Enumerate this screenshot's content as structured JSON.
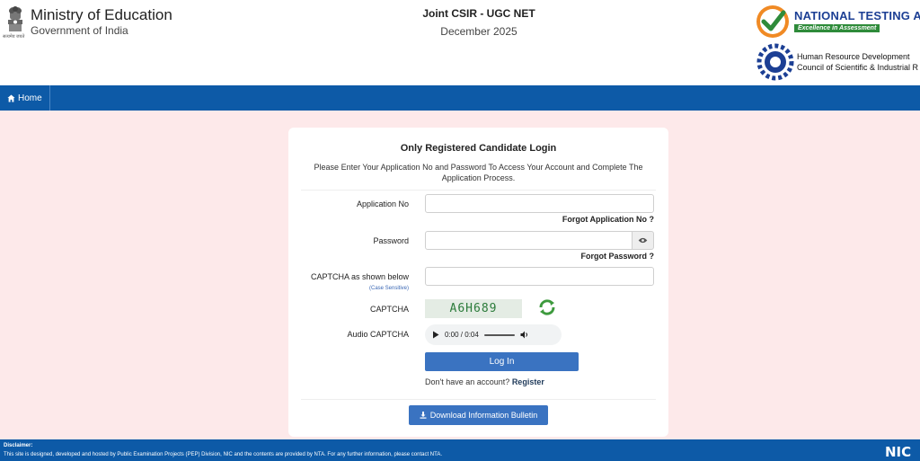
{
  "header": {
    "ministry_title": "Ministry of Education",
    "ministry_sub": "Government of India",
    "emblem_motto": "सत्यमेव जयते",
    "exam_title": "Joint CSIR - UGC NET",
    "exam_session": "December 2025",
    "nta_name": "NATIONAL TESTING AG",
    "nta_tagline": "Excellence in Assessment",
    "csir_line1": "Human Resource Development",
    "csir_line2": "Council of Scientific & Industrial R"
  },
  "nav": {
    "home_label": "Home",
    "home_icon": "home-icon"
  },
  "login": {
    "title": "Only Registered Candidate Login",
    "subtitle": "Please Enter Your Application No and Password To Access Your Account and Complete The Application Process.",
    "application_label": "Application No",
    "forgot_application": "Forgot Application No ?",
    "password_label": "Password",
    "forgot_password": "Forgot Password ?",
    "captcha_input_label": "CAPTCHA as shown below",
    "case_sensitive": "(Case Sensitive)",
    "captcha_label": "CAPTCHA",
    "captcha_text": "A6H689",
    "audio_label": "Audio CAPTCHA",
    "audio_time": "0:00 / 0:04",
    "login_button": "Log In",
    "no_account": "Don't have an account?",
    "register_link": "Register",
    "download_button": "Download Information Bulletin"
  },
  "footer": {
    "disclaimer_title": "Disclaimer:",
    "disclaimer_text": "This site is designed, developed and hosted by Public Examination Projects (PEP) Division, NIC and the contents are provided by NTA. For any further information, please contact NTA.",
    "nic_logo": "NIC"
  },
  "colors": {
    "primary": "#0d5aa7",
    "button": "#3a73c1",
    "page_bg": "#fde9ea",
    "nta_green": "#2e8b3a"
  }
}
